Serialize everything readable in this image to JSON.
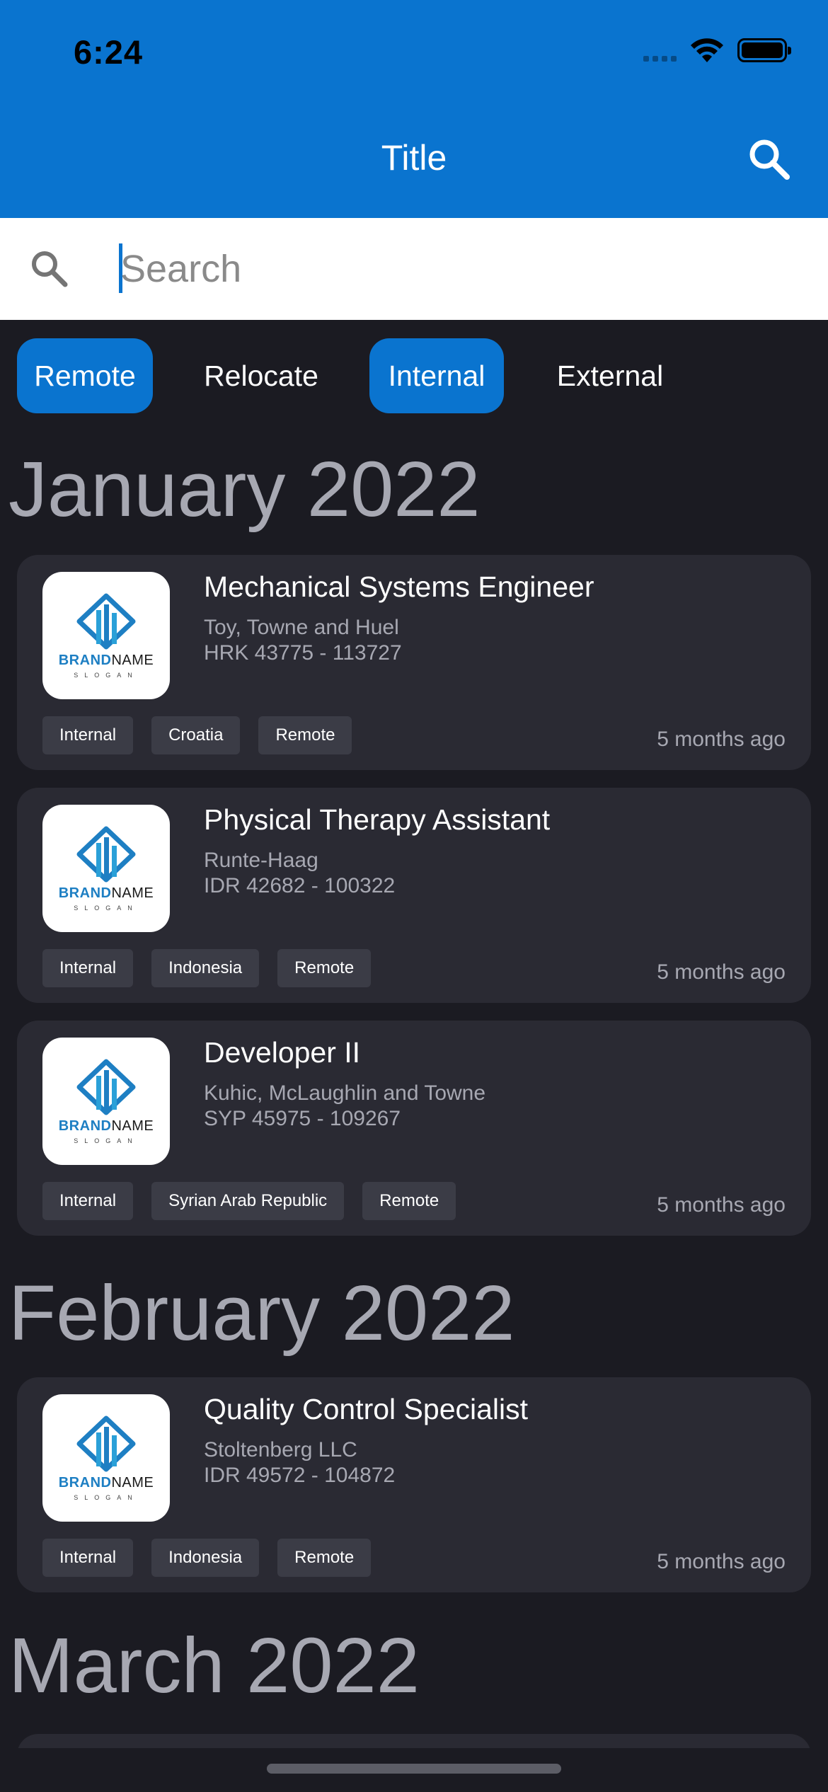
{
  "status_bar": {
    "time": "6:24"
  },
  "header": {
    "title": "Title"
  },
  "search": {
    "placeholder": "Search",
    "value": ""
  },
  "filters": [
    {
      "label": "Remote",
      "active": true
    },
    {
      "label": "Relocate",
      "active": false
    },
    {
      "label": "Internal",
      "active": true
    },
    {
      "label": "External",
      "active": false
    }
  ],
  "logo": {
    "brand_part1": "BRAND",
    "brand_part2": "NAME",
    "slogan": "SLOGAN"
  },
  "sections": [
    {
      "month": "January 2022",
      "jobs": [
        {
          "title": "Mechanical Systems Engineer",
          "company": "Toy, Towne and Huel",
          "salary": "HRK 43775 - 113727",
          "tags": [
            "Internal",
            "Croatia",
            "Remote"
          ],
          "posted": "5 months ago"
        },
        {
          "title": "Physical Therapy Assistant",
          "company": "Runte-Haag",
          "salary": "IDR 42682 - 100322",
          "tags": [
            "Internal",
            "Indonesia",
            "Remote"
          ],
          "posted": "5 months ago"
        },
        {
          "title": "Developer II",
          "company": "Kuhic, McLaughlin and Towne",
          "salary": "SYP 45975 - 109267",
          "tags": [
            "Internal",
            "Syrian Arab Republic",
            "Remote"
          ],
          "posted": "5 months ago"
        }
      ]
    },
    {
      "month": "February 2022",
      "jobs": [
        {
          "title": "Quality Control Specialist",
          "company": "Stoltenberg LLC",
          "salary": "IDR 49572 - 104872",
          "tags": [
            "Internal",
            "Indonesia",
            "Remote"
          ],
          "posted": "5 months ago"
        }
      ]
    },
    {
      "month": "March 2022",
      "jobs": []
    }
  ],
  "colors": {
    "accent": "#0a74cf",
    "background": "#1b1b22",
    "card": "#2a2a33",
    "muted_text": "#a7a8b2"
  }
}
